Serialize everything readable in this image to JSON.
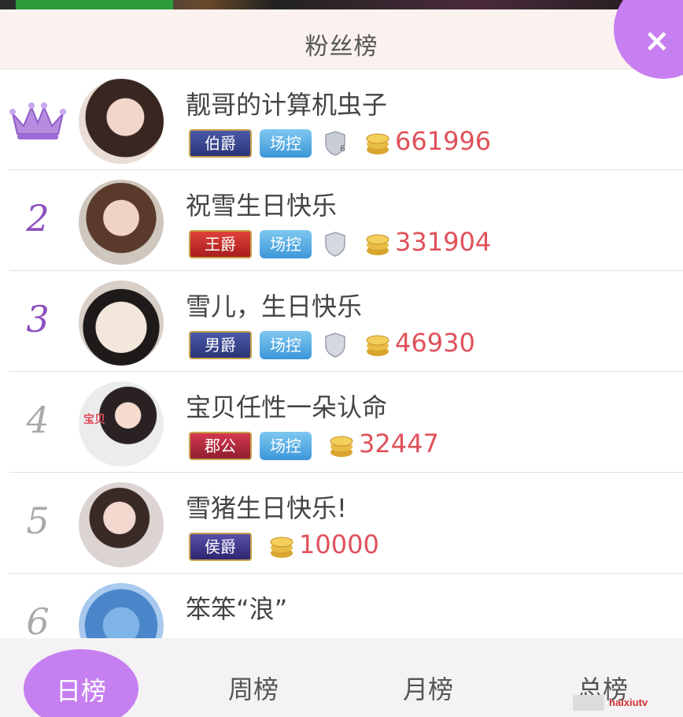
{
  "header": {
    "title": "粉丝榜",
    "close_label": "×"
  },
  "colors": {
    "accent": "#c67ff0",
    "amount": "#e0515a",
    "rank_top": "#8e4fbf"
  },
  "rows": [
    {
      "rank": "",
      "name": "靓哥的计算机虫子",
      "title": "伯爵",
      "control": "场控",
      "shield_level": "6",
      "amount": "661996"
    },
    {
      "rank": "2",
      "name": "祝雪生日快乐",
      "title": "王爵",
      "control": "场控",
      "shield_level": "",
      "amount": "331904"
    },
    {
      "rank": "3",
      "name": "雪儿，生日快乐",
      "title": "男爵",
      "control": "场控",
      "shield_level": "",
      "amount": "46930"
    },
    {
      "rank": "4",
      "name": "宝贝任性一朵认命",
      "title": "郡公",
      "control": "场控",
      "amount": "32447",
      "avatar_text": "宝贝"
    },
    {
      "rank": "5",
      "name": "雪猪生日快乐!",
      "title": "侯爵",
      "amount": "10000"
    },
    {
      "rank": "6",
      "name": "笨笨“浪”"
    }
  ],
  "tabs": [
    "日榜",
    "周榜",
    "月榜",
    "总榜"
  ],
  "watermark": "haixiutv"
}
